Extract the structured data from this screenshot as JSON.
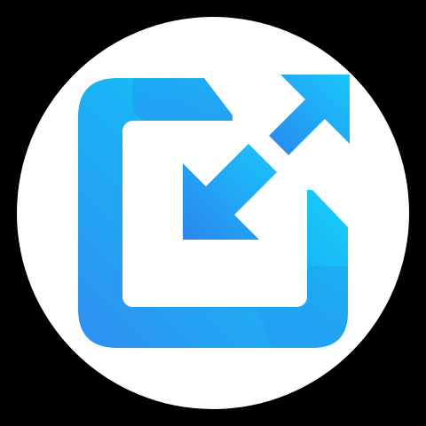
{
  "app_icon": {
    "icon_name": "resize-arrows-app-icon",
    "background_color": "#000000",
    "badge_color": "#ffffff",
    "colors": {
      "gradient_light": "#14e6ff",
      "gradient_mid": "#19b4f5",
      "gradient_dark": "#2f8ff0",
      "inner_square": "#ffffff"
    }
  }
}
